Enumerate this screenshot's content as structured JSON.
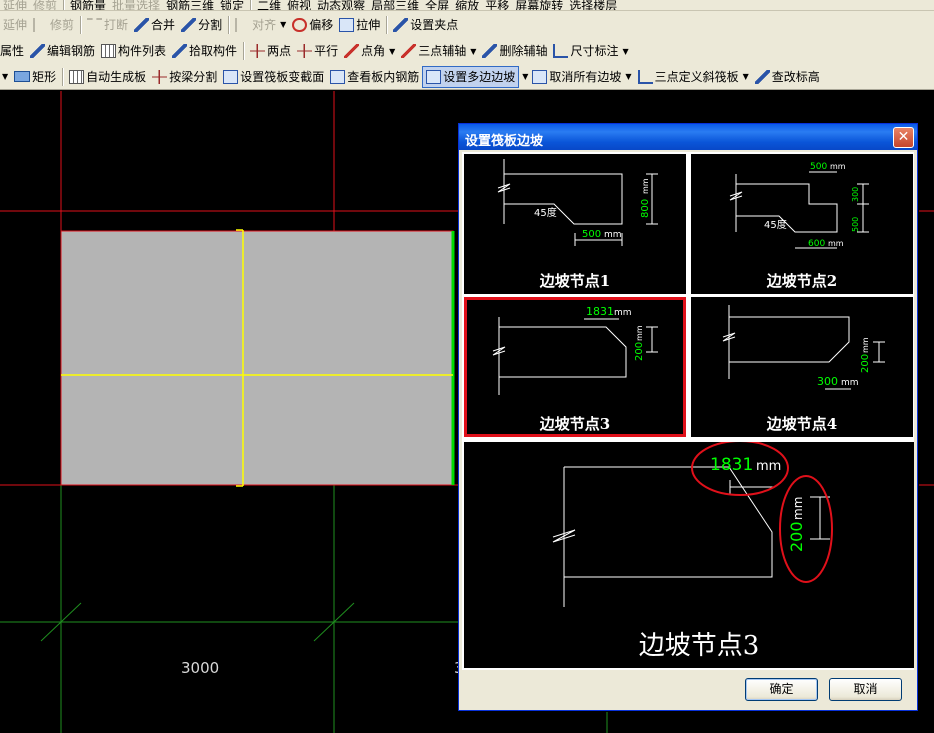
{
  "toolbar_row0": {
    "items": [
      "延伸",
      "修剪",
      "钢筋量",
      "批量选择",
      "钢筋三维",
      "锁定",
      "二维",
      "俯视",
      "动态观察",
      "局部三维",
      "全屏",
      "缩放",
      "平移",
      "屏幕旋转",
      "选择楼层"
    ]
  },
  "toolbar_row1": {
    "items": [
      "延伸",
      "修剪",
      "打断",
      "合并",
      "分割",
      "对齐",
      "偏移",
      "拉伸",
      "设置夹点"
    ]
  },
  "toolbar_row2": {
    "items": [
      "属性",
      "编辑钢筋",
      "构件列表",
      "拾取构件",
      "两点",
      "平行",
      "点角",
      "三点辅轴",
      "删除辅轴",
      "尺寸标注"
    ]
  },
  "toolbar_row3": {
    "items": [
      "矩形",
      "自动生成板",
      "按梁分割",
      "设置筏板变截面",
      "查看板内钢筋",
      "设置多边边坡",
      "取消所有边坡",
      "三点定义斜筏板",
      "查改标高"
    ]
  },
  "canvas": {
    "dimension_label": "3000",
    "dimension_label_2": "3",
    "colors": {
      "slab": "#b4b4b4",
      "grid_red": "#e0101a",
      "grid_green": "#1f8f1f",
      "axis_yellow": "#ffff00"
    }
  },
  "dialog": {
    "title": "设置筏板边坡",
    "close_symbol": "✕",
    "nodes": [
      {
        "label": "边坡节点1",
        "angle": "45度",
        "dim_h": "500",
        "dim_v": "800",
        "unit": "mm"
      },
      {
        "label": "边坡节点2",
        "angle": "45度",
        "dim_top": "500",
        "dim_bottom": "600",
        "dim_v1": "300",
        "dim_v2": "500",
        "unit": "mm"
      },
      {
        "label": "边坡节点3",
        "dim_top": "1831",
        "dim_v": "200",
        "unit": "mm",
        "selected": true
      },
      {
        "label": "边坡节点4",
        "dim_bottom": "300",
        "dim_v": "200",
        "unit": "mm"
      }
    ],
    "preview": {
      "label": "边坡节点3",
      "dim_top": "1831",
      "dim_v": "200",
      "unit": "mm"
    },
    "ok_label": "确定",
    "cancel_label": "取消"
  }
}
